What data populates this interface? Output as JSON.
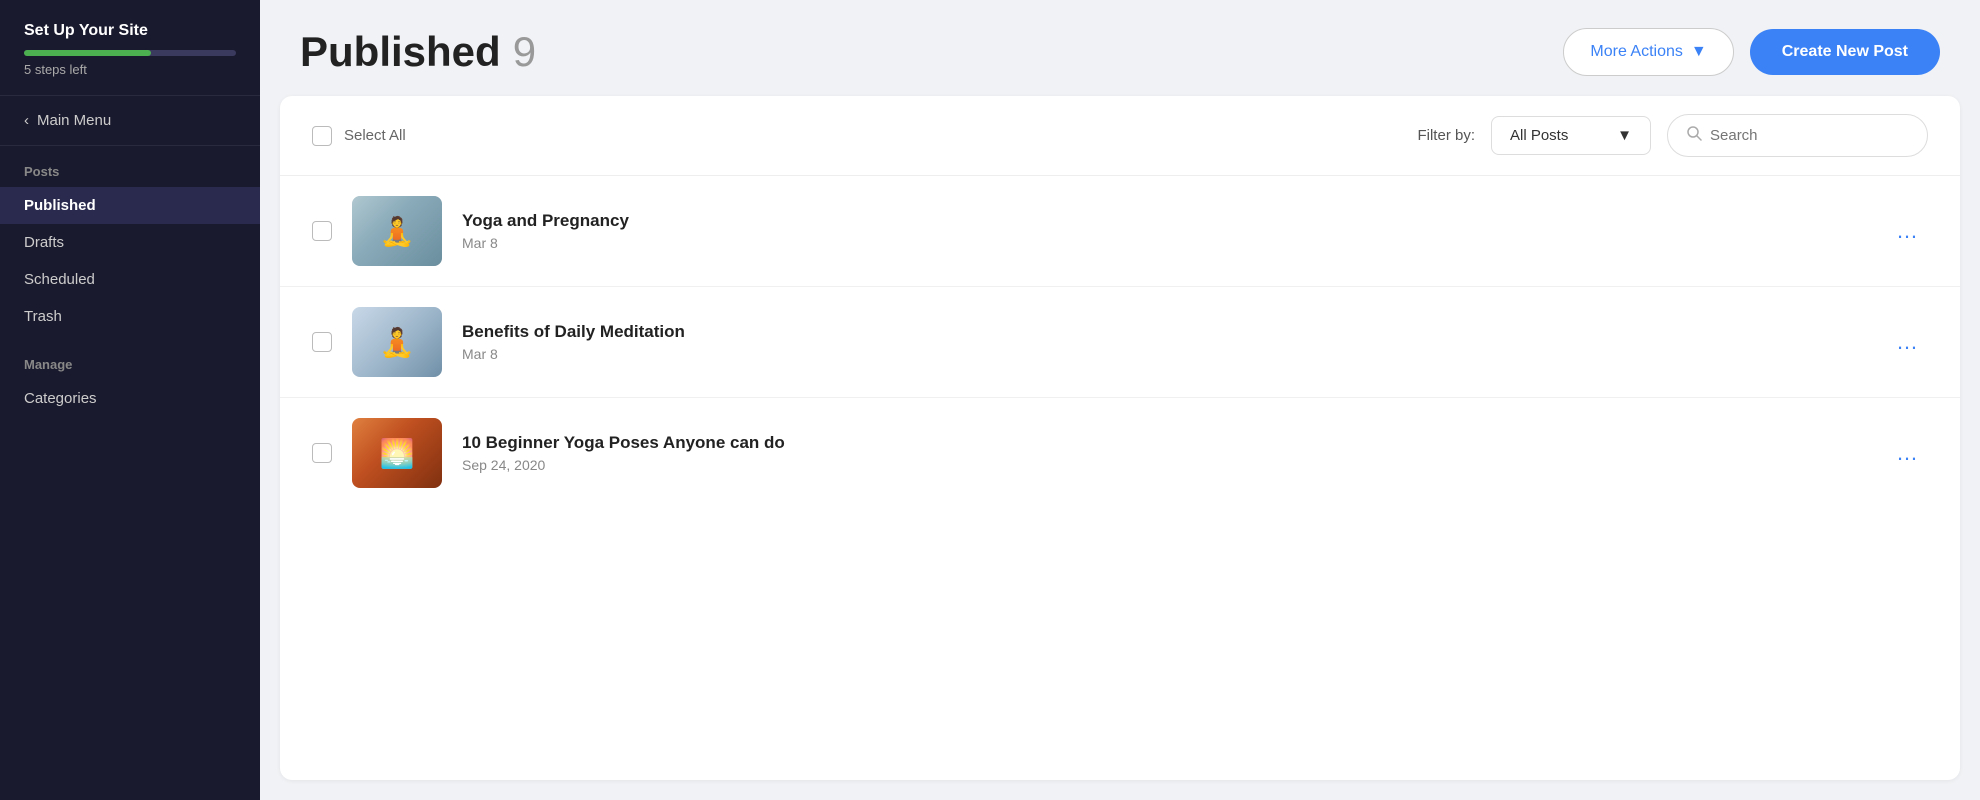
{
  "sidebar": {
    "setup_title": "Set Up Your Site",
    "steps_left": "5 steps left",
    "progress_percent": 60,
    "main_menu_label": "Main Menu",
    "sections": [
      {
        "label": "Posts",
        "items": [
          {
            "id": "published",
            "label": "Published",
            "active": true
          },
          {
            "id": "drafts",
            "label": "Drafts",
            "active": false
          },
          {
            "id": "scheduled",
            "label": "Scheduled",
            "active": false
          },
          {
            "id": "trash",
            "label": "Trash",
            "active": false
          }
        ]
      },
      {
        "label": "Manage",
        "items": [
          {
            "id": "categories",
            "label": "Categories",
            "active": false
          }
        ]
      }
    ]
  },
  "header": {
    "title": "Published",
    "count": "9",
    "more_actions_label": "More Actions",
    "create_button_label": "Create New Post"
  },
  "toolbar": {
    "select_all_label": "Select All",
    "filter_label": "Filter by:",
    "filter_value": "All Posts",
    "search_placeholder": "Search"
  },
  "posts": [
    {
      "id": "post-1",
      "title": "Yoga and Pregnancy",
      "date": "Mar 8",
      "thumb_type": "yoga1"
    },
    {
      "id": "post-2",
      "title": "Benefits of Daily Meditation",
      "date": "Mar 8",
      "thumb_type": "yoga2"
    },
    {
      "id": "post-3",
      "title": "10 Beginner Yoga Poses Anyone can do",
      "date": "Sep 24, 2020",
      "thumb_type": "yoga3"
    }
  ]
}
